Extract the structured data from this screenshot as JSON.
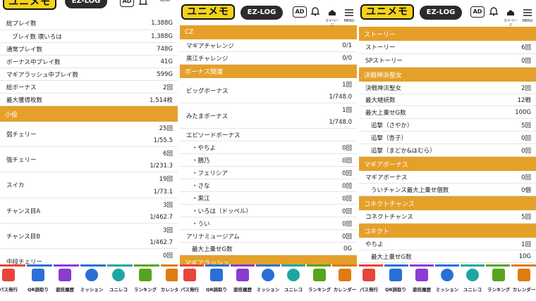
{
  "header": {
    "logo": "ユニメモ",
    "ezlog": "EZ-LOG",
    "ad": "AD",
    "mypage": "マイページ",
    "menu": "MENU"
  },
  "colors": {
    "accent": "#e5a02a",
    "logo_yellow": "#f5d21a"
  },
  "nav": [
    {
      "label": "パス発行",
      "icon": "key-icon",
      "color": "#e8443a"
    },
    {
      "label": "QR読取り",
      "icon": "qr-icon",
      "color": "#2a6fd6"
    },
    {
      "label": "遊技履歴",
      "icon": "history-icon",
      "color": "#8a3bd1"
    },
    {
      "label": "ミッション",
      "icon": "target-icon",
      "color": "#2a6fd6"
    },
    {
      "label": "ユニレコ",
      "icon": "unireco-icon",
      "color": "#1fa6a0"
    },
    {
      "label": "ランキング",
      "icon": "crown-icon",
      "color": "#55a51c"
    },
    {
      "label": "カレンダー",
      "icon": "calendar-icon",
      "color": "#e07b10"
    }
  ],
  "panel0": {
    "rows": [
      {
        "label": "総プレイ数",
        "value": "1,388G"
      },
      {
        "label": "プレイ数 環いろは",
        "value": "1,388G",
        "indent": true
      },
      {
        "label": "通常プレイ数",
        "value": "748G"
      },
      {
        "label": "ボーナス中プレイ数",
        "value": "41G"
      },
      {
        "label": "マギアラッシュ中プレイ数",
        "value": "599G"
      },
      {
        "label": "総ボーナス",
        "value": "2回"
      },
      {
        "label": "最大獲得枚数",
        "value": "1,514枚"
      }
    ],
    "section": "小役",
    "koyaku": [
      {
        "label": "弱チェリー",
        "count": "25回",
        "rate": "1/55.5"
      },
      {
        "label": "強チェリー",
        "count": "6回",
        "rate": "1/231.3"
      },
      {
        "label": "スイカ",
        "count": "19回",
        "rate": "1/73.1"
      },
      {
        "label": "チャンス目A",
        "count": "3回",
        "rate": "1/462.7"
      },
      {
        "label": "チャンス目B",
        "count": "3回",
        "rate": "1/462.7"
      },
      {
        "label": "中段チェリー",
        "count": "0回",
        "rate": ""
      }
    ]
  },
  "panel1": {
    "sec_cz": "CZ",
    "cz": [
      {
        "label": "マギアチャレンジ",
        "value": "0/1"
      },
      {
        "label": "黒江チャレンジ",
        "value": "0/0"
      }
    ],
    "sec_bonus": "ボーナス関連",
    "big": {
      "label": "ビッグボーナス",
      "count": "1回",
      "rate": "1/748.0"
    },
    "mitama": {
      "label": "みたまボーナス",
      "count": "1回",
      "rate": "1/748.0"
    },
    "episode": {
      "label": "エピソードボーナス",
      "value": ""
    },
    "episode_items": [
      {
        "label": "・やちよ",
        "value": "0回"
      },
      {
        "label": "・鶴乃",
        "value": "0回"
      },
      {
        "label": "・フェリシア",
        "value": "0回"
      },
      {
        "label": "・さな",
        "value": "0回"
      },
      {
        "label": "・黒江",
        "value": "0回"
      },
      {
        "label": "・いろは（ドッペル）",
        "value": "0回"
      },
      {
        "label": "・うい",
        "value": "0回"
      }
    ],
    "arina": {
      "label": "アリナミュージアム",
      "value": "0回"
    },
    "arina_max": {
      "label": "最大上乗せG数",
      "value": "0G"
    },
    "sec_magia": "マギアラッシュ"
  },
  "panel2": {
    "sec_story": "ストーリー",
    "story": [
      {
        "label": "ストーリー",
        "value": "6回"
      },
      {
        "label": "SPストーリー",
        "value": "0回"
      }
    ],
    "sec_kessen": "決戦神浜聖女",
    "kessen": [
      {
        "label": "決戦神浜聖女",
        "value": "2回"
      },
      {
        "label": "最大継続数",
        "value": "12戦"
      },
      {
        "label": "最大上乗せG数",
        "value": "100G"
      },
      {
        "label": "追撃（さやか）",
        "value": "5回",
        "indent": true
      },
      {
        "label": "追撃（杏子）",
        "value": "0回",
        "indent": true
      },
      {
        "label": "追撃（まどか&ほむら）",
        "value": "0回",
        "indent": true
      }
    ],
    "sec_magia": "マギアボーナス",
    "magia": [
      {
        "label": "マギアボーナス",
        "value": "0回"
      },
      {
        "label": "ういチャンス最大上乗せ個数",
        "value": "0個",
        "indent": true
      }
    ],
    "sec_connect_chance": "コネクトチャンス",
    "connect_chance": [
      {
        "label": "コネクトチャンス",
        "value": "5回"
      }
    ],
    "sec_connect": "コネクト",
    "connect": [
      {
        "label": "やちよ",
        "value": "1回"
      },
      {
        "label": "最大上乗せG数",
        "value": "10G",
        "indent": true
      }
    ]
  }
}
